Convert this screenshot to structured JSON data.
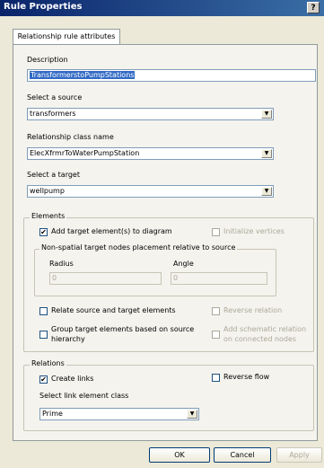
{
  "window": {
    "title": "Rule Properties",
    "help_label": "?"
  },
  "tab": {
    "label": "Relationship rule attributes"
  },
  "description": {
    "label": "Description",
    "value": "TransformerstoPumpStations"
  },
  "source": {
    "label": "Select a source",
    "value": "transformers"
  },
  "relclass": {
    "label": "Relationship class name",
    "value": "ElecXfrmrToWaterPumpStation"
  },
  "target": {
    "label": "Select a target",
    "value": "wellpump"
  },
  "elements": {
    "title": "Elements",
    "add_target": {
      "label": "Add target element(s) to diagram",
      "checked": true
    },
    "init_vertices": {
      "label": "Initialize vertices",
      "checked": false,
      "enabled": false
    },
    "placement": {
      "title": "Non-spatial target nodes placement relative to source",
      "radius_label": "Radius",
      "radius_value": "0",
      "angle_label": "Angle",
      "angle_value": "0"
    },
    "relate": {
      "label": "Relate source and target elements",
      "checked": false
    },
    "reverse_relation": {
      "label": "Reverse relation",
      "checked": false,
      "enabled": false
    },
    "group": {
      "label_line1": "Group target elements based on source",
      "label_line2": "hierarchy",
      "checked": false
    },
    "add_schematic": {
      "label_line1": "Add schematic relation",
      "label_line2": "on connected nodes",
      "checked": false,
      "enabled": false
    }
  },
  "relations": {
    "title": "Relations",
    "create_links": {
      "label": "Create links",
      "checked": true
    },
    "reverse_flow": {
      "label": "Reverse flow",
      "checked": false
    },
    "link_class": {
      "label": "Select link element class",
      "value": "Prime"
    }
  },
  "buttons": {
    "ok": "OK",
    "cancel": "Cancel",
    "apply": "Apply"
  },
  "icons": {
    "check": "✔",
    "dropdown": "▼"
  }
}
